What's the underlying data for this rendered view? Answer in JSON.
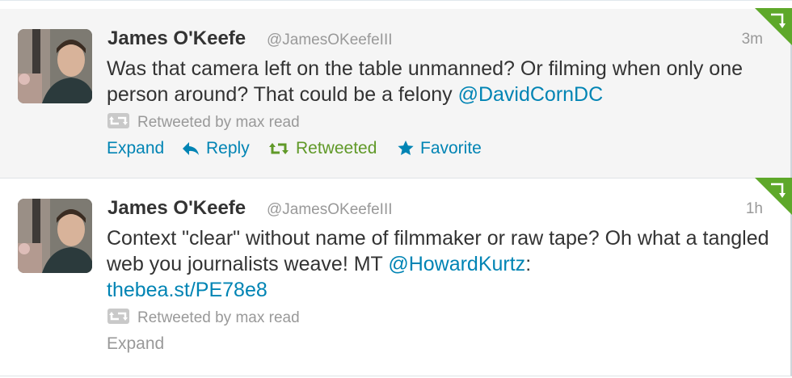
{
  "colors": {
    "link": "#0084b4",
    "retweeted": "#609928",
    "muted": "#999999",
    "text": "#333333",
    "corner_badge": "#5ea82a"
  },
  "tweets": [
    {
      "fullname": "James O'Keefe",
      "username": "@JamesOKeefeIII",
      "time": "3m",
      "text_parts": {
        "t1": "Was that camera left on the table unmanned? Or filming when only one person around? That could be a felony ",
        "mention": "@DavidCornDC"
      },
      "context": {
        "icon": "retweet-icon",
        "label": "Retweeted by max read"
      },
      "actions": {
        "expand": "Expand",
        "reply": "Reply",
        "retweeted": "Retweeted",
        "favorite": "Favorite"
      },
      "corner_icon": "retweet-corner-badge-icon"
    },
    {
      "fullname": "James O'Keefe",
      "username": "@JamesOKeefeIII",
      "time": "1h",
      "text_parts": {
        "t1": "Context \"clear\" without name of filmmaker or raw tape? Oh what a tangled web you journalists weave! MT ",
        "mention": "@HowardKurtz",
        "t2": ":",
        "url": "thebea.st/PE78e8"
      },
      "context": {
        "icon": "retweet-icon",
        "label": "Retweeted by max read"
      },
      "actions": {
        "expand": "Expand"
      },
      "corner_icon": "retweet-corner-badge-icon"
    }
  ]
}
